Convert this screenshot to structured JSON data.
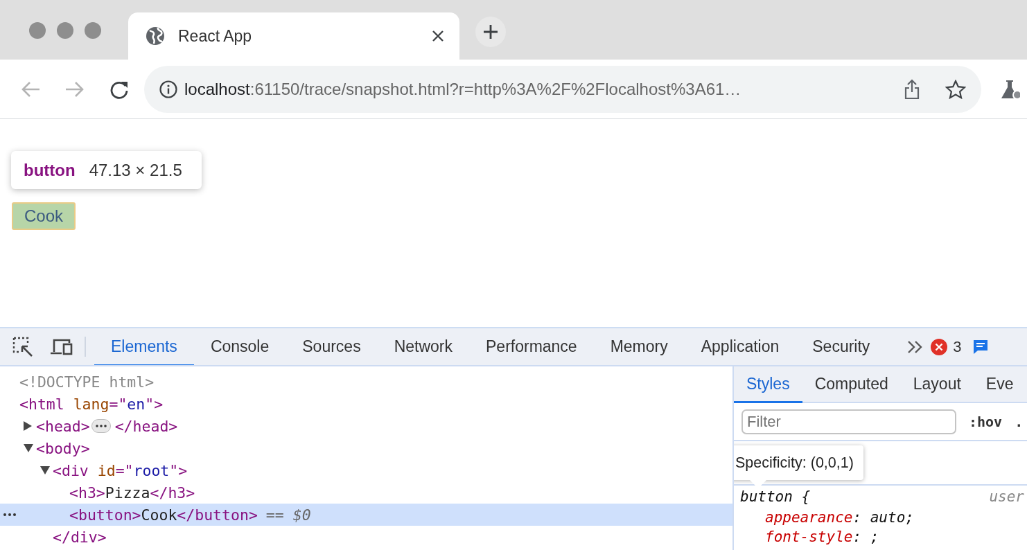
{
  "browser": {
    "tab": {
      "title": "React App"
    },
    "address": {
      "host": "localhost",
      "path": ":61150/trace/snapshot.html?r=http%3A%2F%2Flocalhost%3A61…"
    }
  },
  "page": {
    "button": {
      "label": "Cook"
    },
    "inspect_tooltip": {
      "tag": "button",
      "size": "47.13 × 21.5"
    }
  },
  "devtools": {
    "tabs": [
      {
        "label": "Elements",
        "selected": true
      },
      {
        "label": "Console",
        "selected": false
      },
      {
        "label": "Sources",
        "selected": false
      },
      {
        "label": "Network",
        "selected": false
      },
      {
        "label": "Performance",
        "selected": false
      },
      {
        "label": "Memory",
        "selected": false
      },
      {
        "label": "Application",
        "selected": false
      },
      {
        "label": "Security",
        "selected": false
      }
    ],
    "error_count": "3",
    "dom": [
      {
        "parts": [
          {
            "kind": "doctype",
            "text": "<!DOCTYPE html>"
          }
        ],
        "selected": false
      },
      {
        "parts": [
          {
            "kind": "tag",
            "text": "<html"
          },
          {
            "kind": "attr",
            "text": " lang"
          },
          {
            "kind": "tag",
            "text": "=\""
          },
          {
            "kind": "value",
            "text": "en"
          },
          {
            "kind": "tag",
            "text": "\">"
          }
        ],
        "selected": false,
        "children": [
          {
            "parts": [
              {
                "kind": "tag",
                "text": "<head>"
              }
            ],
            "expanded": false,
            "end": "</head>",
            "selected": false
          },
          {
            "parts": [
              {
                "kind": "tag",
                "text": "<body>"
              }
            ],
            "expanded": true,
            "selected": false,
            "children": [
              {
                "parts": [
                  {
                    "kind": "tag",
                    "text": "<div"
                  },
                  {
                    "kind": "attr",
                    "text": " id"
                  },
                  {
                    "kind": "tag",
                    "text": "=\""
                  },
                  {
                    "kind": "value",
                    "text": "root"
                  },
                  {
                    "kind": "tag",
                    "text": "\">"
                  }
                ],
                "expanded": true,
                "selected": false,
                "close": "</div>",
                "children": [
                  {
                    "parts": [
                      {
                        "kind": "tag",
                        "text": "<h3>"
                      },
                      {
                        "kind": "text",
                        "text": "Pizza"
                      },
                      {
                        "kind": "tag",
                        "text": "</h3>"
                      }
                    ],
                    "selected": false
                  },
                  {
                    "parts": [
                      {
                        "kind": "tag",
                        "text": "<button>"
                      },
                      {
                        "kind": "text",
                        "text": "Cook"
                      },
                      {
                        "kind": "tag",
                        "text": "</button>"
                      }
                    ],
                    "marker": "== *$0*",
                    "selected": true
                  }
                ]
              }
            ]
          }
        ]
      }
    ],
    "styles": {
      "tabs": [
        {
          "label": "Styles",
          "selected": true
        },
        {
          "label": "Computed",
          "selected": false
        },
        {
          "label": "Layout",
          "selected": false
        },
        {
          "label": "Eve",
          "selected": false
        }
      ],
      "filter": {
        "placeholder": "Filter"
      },
      "hov": ":hov",
      "cls": ".",
      "tooltip": "Specificity: (0,0,1)",
      "rules": [
        {
          "selector": "button {",
          "source": "user",
          "props": [
            {
              "name": "appearance",
              "value": ": auto;"
            },
            {
              "name": "font-style",
              "value": ": ;"
            }
          ]
        }
      ]
    }
  }
}
